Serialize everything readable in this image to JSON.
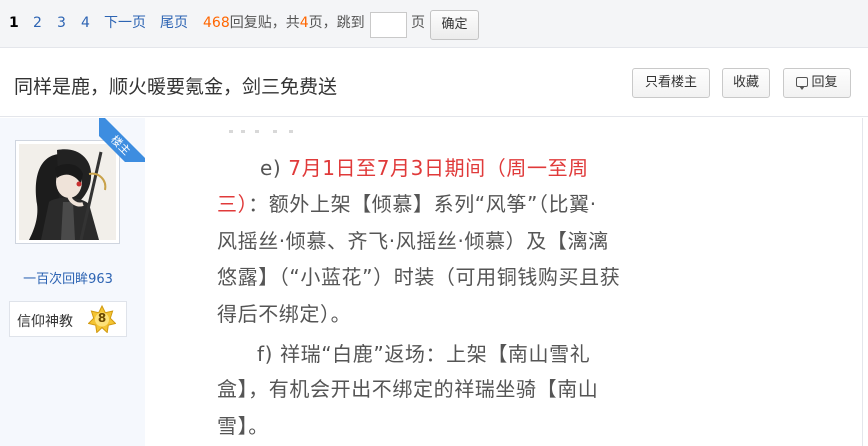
{
  "pager": {
    "current": "1",
    "pages": [
      "2",
      "3",
      "4"
    ],
    "next": "下一页",
    "last": "尾页",
    "reply_count": "468",
    "reply_suffix": "回复贴，共",
    "page_total": "4",
    "page_suffix": "页，跳到",
    "page_unit": "页",
    "jump_value": "",
    "confirm": "确定"
  },
  "thread": {
    "title": "同样是鹿，顺火暖要氪金，剑三免费送",
    "only_op": "只看楼主",
    "favorite": "收藏",
    "reply": "回复"
  },
  "author": {
    "ribbon": "楼主",
    "name": "一百次回眸963",
    "level_name": "信仰神教",
    "level": "8"
  },
  "post": {
    "line1_a": "e)     ",
    "line1_red": "7月1日至7月3日期间（周一至周",
    "line2_red": "三）",
    "line2_b": "：额外上架【倾慕】系列“风筝”（比翼·",
    "line3": "风摇丝·倾慕、齐飞·风摇丝·倾慕）及【漓漓",
    "line4": "悠露】（“小蓝花”）时装（可用铜钱购买且获",
    "line5": "得后不绑定）。",
    "line6": "f)      祥瑞“白鹿”返场：上架【南山雪礼",
    "line7": "盒】，有机会开出不绑定的祥瑞坐骑【南山",
    "line8": "雪】。"
  },
  "colors": {
    "link": "#2d64b3",
    "accent_orange": "#ff6600",
    "ribbon": "#3d8de0",
    "highlight_red": "#e03a3a"
  },
  "icons": {
    "reply": "speech-bubble-icon",
    "level_badge": "star-badge-icon"
  }
}
